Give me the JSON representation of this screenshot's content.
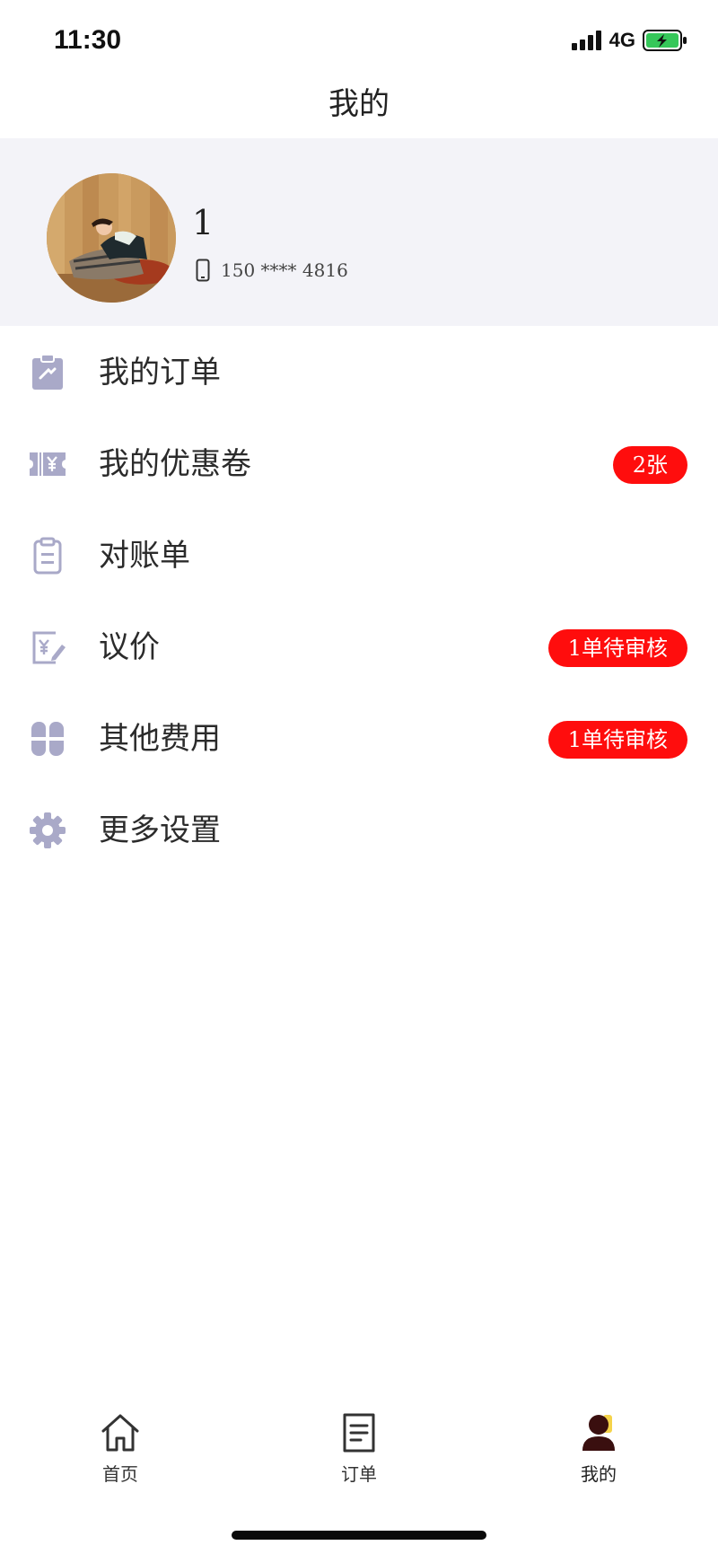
{
  "status_bar": {
    "time": "11:30",
    "network": "4G",
    "signal_icon": "signal-bars-icon",
    "battery_icon": "battery-charging-icon"
  },
  "header": {
    "title": "我的"
  },
  "profile": {
    "name": "1",
    "phone": "150 **** 4816",
    "phone_icon": "phone-icon"
  },
  "menu": {
    "items": [
      {
        "label": "我的订单",
        "icon": "clipboard-order-icon",
        "badge": ""
      },
      {
        "label": "我的优惠卷",
        "icon": "coupon-ticket-icon",
        "badge": "2张"
      },
      {
        "label": "对账单",
        "icon": "statement-clipboard-icon",
        "badge": ""
      },
      {
        "label": "议价",
        "icon": "price-edit-icon",
        "badge": "1单待审核"
      },
      {
        "label": "其他费用",
        "icon": "four-petals-icon",
        "badge": "1单待审核"
      },
      {
        "label": "更多设置",
        "icon": "gear-icon",
        "badge": ""
      }
    ]
  },
  "tab_bar": {
    "tabs": [
      {
        "label": "首页",
        "icon": "home-icon",
        "active": false
      },
      {
        "label": "订单",
        "icon": "order-document-icon",
        "active": false
      },
      {
        "label": "我的",
        "icon": "user-profile-icon",
        "active": true
      }
    ]
  },
  "colors": {
    "badge_bg": "#ff0d0d",
    "profile_bg": "#f3f3f8",
    "icon_color": "#a9a9c8",
    "battery_green": "#35c759"
  }
}
